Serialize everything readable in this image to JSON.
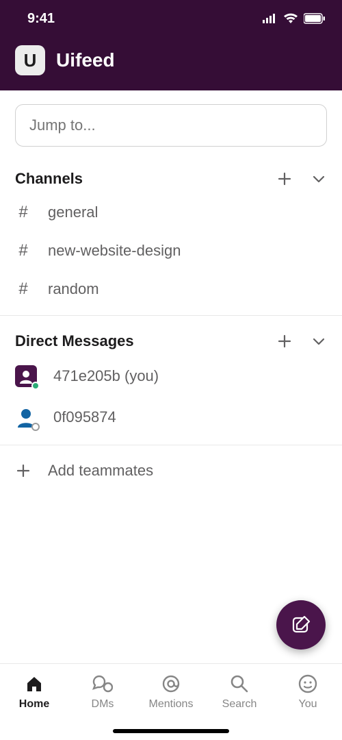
{
  "status": {
    "time": "9:41"
  },
  "workspace": {
    "initial": "U",
    "name": "Uifeed"
  },
  "search": {
    "placeholder": "Jump to..."
  },
  "channels": {
    "title": "Channels",
    "items": [
      {
        "name": "general"
      },
      {
        "name": "new-website-design"
      },
      {
        "name": "random"
      }
    ]
  },
  "dms": {
    "title": "Direct Messages",
    "items": [
      {
        "name": "471e205b (you)",
        "self": true,
        "presence": "active"
      },
      {
        "name": "0f095874",
        "self": false,
        "presence": "away"
      }
    ]
  },
  "addTeammates": "Add teammates",
  "nav": {
    "home": "Home",
    "dms": "DMs",
    "mentions": "Mentions",
    "search": "Search",
    "you": "You"
  }
}
